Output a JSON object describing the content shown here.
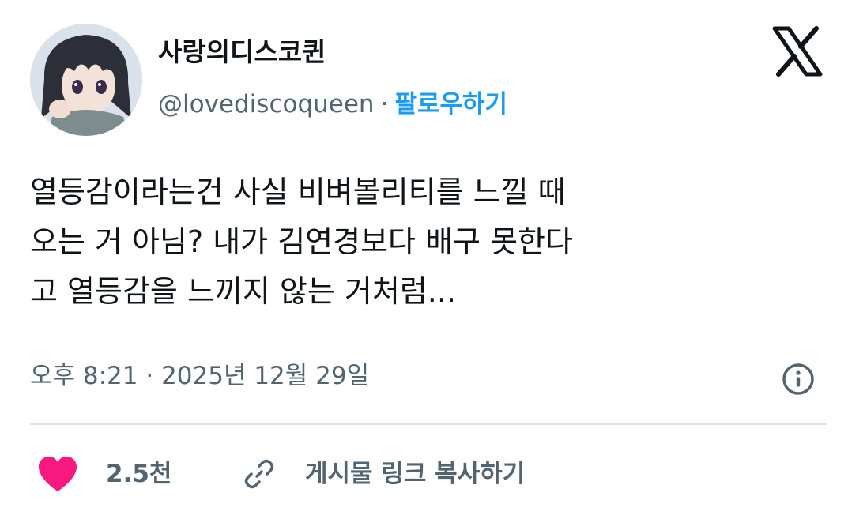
{
  "author": {
    "display_name": "사랑의디스코퀸",
    "handle": "@lovediscoqueen",
    "separator": "·",
    "follow_label": "팔로우하기"
  },
  "tweet": {
    "lines": [
      "열등감이라는건 사실 비벼볼리티를 느낄 때",
      "오는 거 아님? 내가 김연경보다 배구 못한다",
      "고 열등감을 느끼지 않는 거처럼..."
    ],
    "timestamp": "오후 8:21 · 2025년 12월 29일"
  },
  "actions": {
    "like_count": "2.5천",
    "copy_link_label": "게시물 링크 복사하기"
  },
  "icons": {
    "platform": "x-logo-icon",
    "info": "info-icon",
    "like": "heart-icon",
    "link": "link-icon"
  },
  "colors": {
    "follow": "#1d9bf0",
    "like": "#f91880",
    "secondary_text": "#536471",
    "primary_text": "#0f1419"
  }
}
